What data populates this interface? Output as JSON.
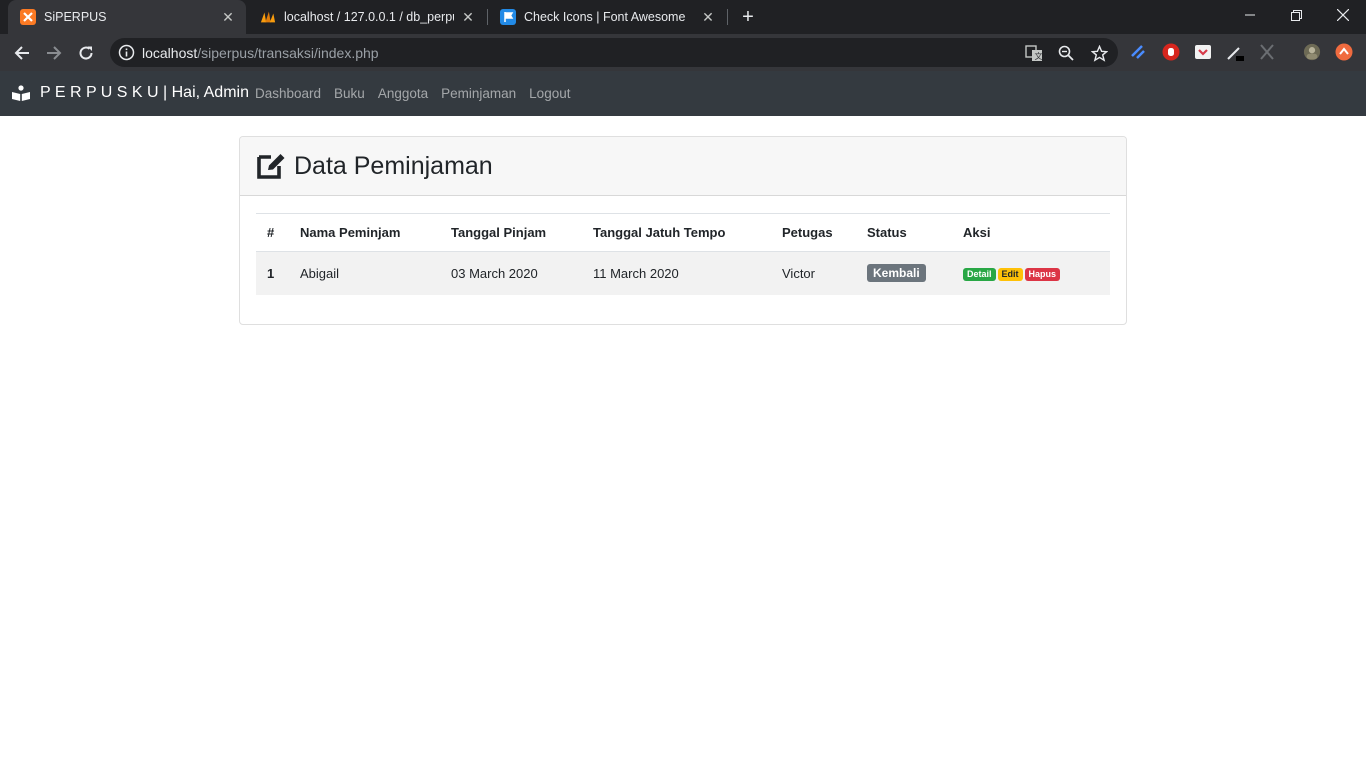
{
  "browser": {
    "tabs": [
      {
        "title": "SiPERPUS",
        "icon": "xampp-icon",
        "active": true
      },
      {
        "title": "localhost / 127.0.0.1 / db_perpus",
        "icon": "phpmyadmin-icon",
        "active": false
      },
      {
        "title": "Check Icons | Font Awesome",
        "icon": "font-awesome-flag-icon",
        "active": false
      }
    ],
    "url_host": "localhost",
    "url_path": "/siperpus/transaksi/index.php"
  },
  "navbar": {
    "brand": "P E R P U S K U | Hai, Admin",
    "links": [
      "Dashboard",
      "Buku",
      "Anggota",
      "Peminjaman",
      "Logout"
    ]
  },
  "page": {
    "title": "Data Peminjaman",
    "table": {
      "headers": [
        "#",
        "Nama Peminjam",
        "Tanggal Pinjam",
        "Tanggal Jatuh Tempo",
        "Petugas",
        "Status",
        "Aksi"
      ],
      "rows": [
        {
          "no": "1",
          "nama": "Abigail",
          "tanggal_pinjam": "03 March 2020",
          "jatuh_tempo": "11 March 2020",
          "petugas": "Victor",
          "status": "Kembali",
          "actions": [
            "Detail",
            "Edit",
            "Hapus"
          ]
        }
      ]
    }
  },
  "colors": {
    "navbar_bg": "#343a40",
    "status_badge": "#6c757d",
    "detail": "#28a745",
    "edit": "#ffc107",
    "hapus": "#dc3545"
  }
}
